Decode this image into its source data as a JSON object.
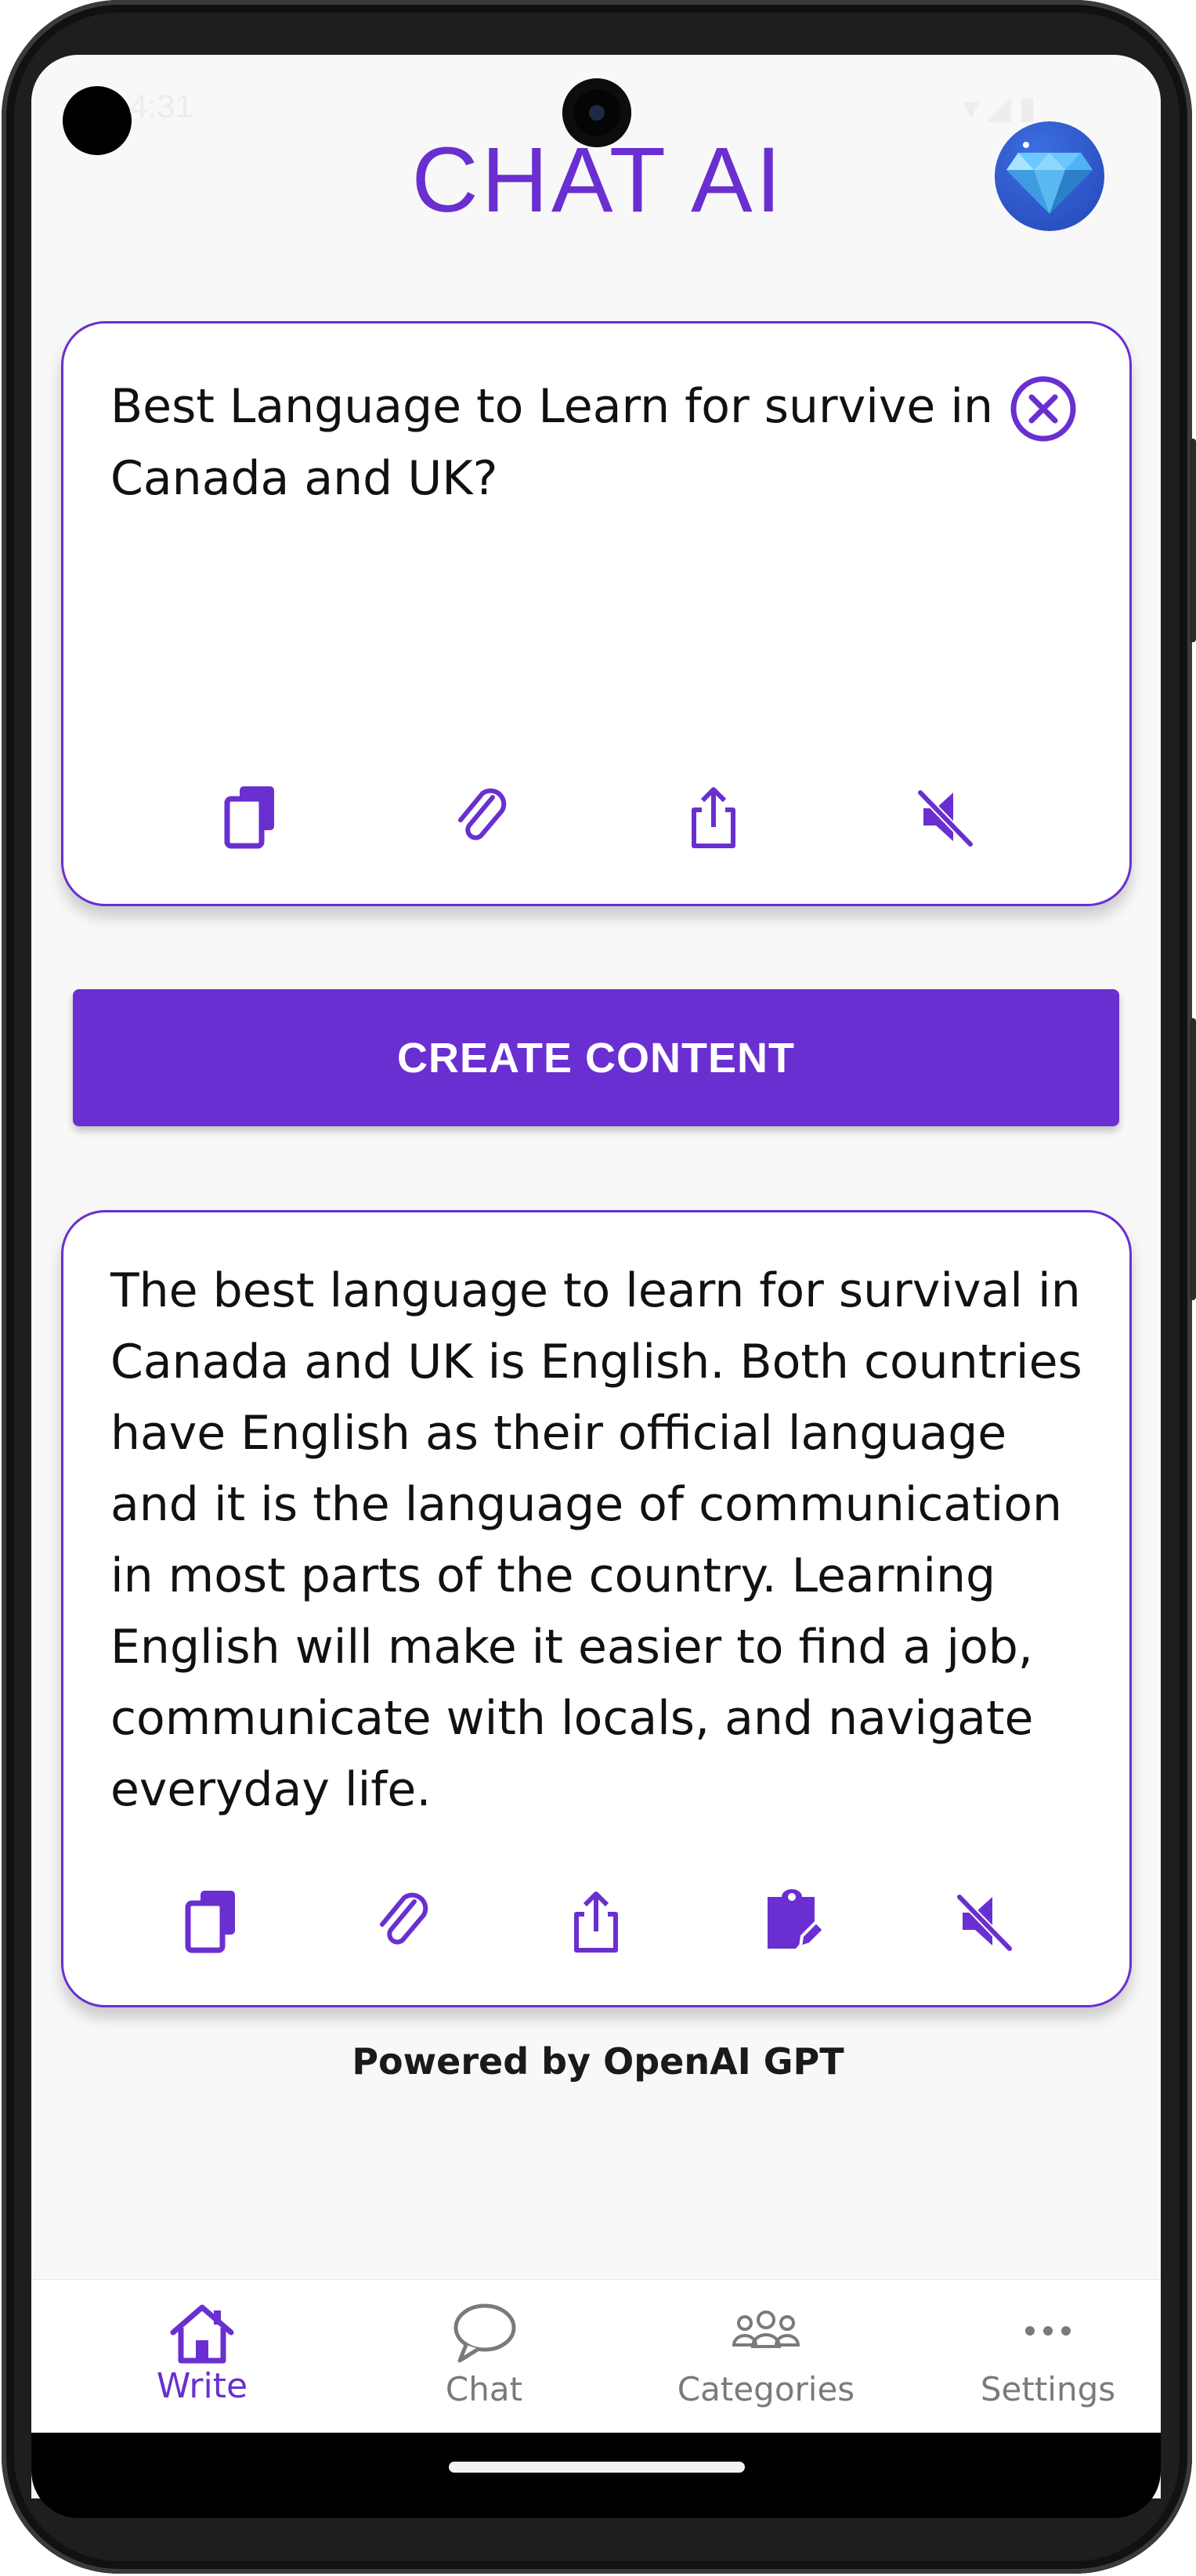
{
  "status_bar": {
    "time": "4:31",
    "icons": "▾◢▮"
  },
  "header": {
    "title": "CHAT AI",
    "premium_icon": "diamond-icon"
  },
  "input_card": {
    "prompt": "Best Language to Learn for survive in Canada and UK?",
    "actions": [
      "copy-icon",
      "attach-icon",
      "share-icon",
      "mute-icon"
    ]
  },
  "create_button": {
    "label": "CREATE CONTENT"
  },
  "output_card": {
    "response": "The best language to learn for survival in Canada and UK is English. Both countries have English as their official language and it is the language of communication in most parts of the country. Learning English will make it easier to find a job, communicate with locals, and navigate everyday life.",
    "actions": [
      "copy-icon",
      "attach-icon",
      "share-icon",
      "paste-edit-icon",
      "mute-icon"
    ]
  },
  "footer": {
    "powered_by": "Powered by OpenAI GPT"
  },
  "bottom_nav": {
    "tabs": [
      {
        "label": "Write",
        "icon": "home-icon",
        "active": true
      },
      {
        "label": "Chat",
        "icon": "chat-bubble-icon",
        "active": false
      },
      {
        "label": "Categories",
        "icon": "group-icon",
        "active": false
      },
      {
        "label": "Settings",
        "icon": "more-horizontal-icon",
        "active": false
      }
    ]
  },
  "colors": {
    "accent": "#6a2fd0",
    "background": "#f8f8f8",
    "card": "#ffffff",
    "text": "#111111"
  }
}
